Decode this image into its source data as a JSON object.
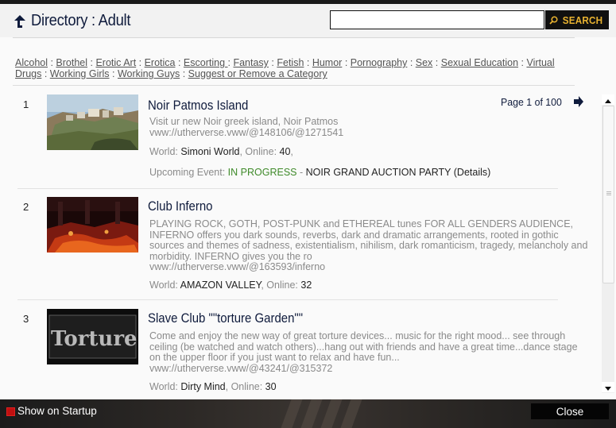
{
  "header": {
    "title": "Directory : Adult",
    "search_placeholder": "",
    "search_label": "SEARCH"
  },
  "categories": [
    "Alcohol",
    "Brothel",
    "Erotic Art",
    "Erotica",
    "Escorting ",
    "Fantasy",
    "Fetish",
    "Humor",
    "Pornography",
    "Sex",
    "Sexual Education",
    "Virtual Drugs",
    "Working Girls",
    "Working Guys",
    "Suggest or Remove a Category"
  ],
  "pager": {
    "text": "Page 1 of 100"
  },
  "items": [
    {
      "index": "1",
      "name": "Noir Patmos Island",
      "description": "Visit ur new Noir greek island, Noir Patmos",
      "url": "vww://utherverse.vww/@148106/@1271541",
      "world_label": "World: ",
      "world": "Simoni World",
      "online_label": ", Online: ",
      "online": "40",
      "online_suffix": ",",
      "event_label": "Upcoming Event: ",
      "event_status": "IN PROGRESS",
      "event_sep": " - ",
      "event_name": "NOIR GRAND AUCTION PARTY (Details)"
    },
    {
      "index": "2",
      "name": "Club Inferno",
      "description": "PLAYING ROCK, GOTH, POST-PUNK and  ETHEREAL tunes FOR ALL GENDERS AUDIENCE, INFERNO offers you dark sounds, reverbs, dark and dramatic arrangements, rooted in gothic sources and themes of sadness, existentialism, nihilism, dark romanticism, tragedy, melancholy and morbidity. INFERNO gives you the ro",
      "url": "vww://utherverse.vww/@163593/inferno",
      "world_label": "World: ",
      "world": "AMAZON VALLEY",
      "online_label": ", Online: ",
      "online": "32"
    },
    {
      "index": "3",
      "name": "Slave Club \"\"torture Garden\"\"",
      "description": "Come and enjoy the new way of great torture devices... music for the right mood... see through ceiling (be watched and watch others)...hang out with friends and have a great time...dance stage on the upper floor if you just want to relax and have fun...",
      "url": "vww://utherverse.vww/@43241/@315372",
      "world_label": "World: ",
      "world": "Dirty Mind",
      "online_label": ", Online: ",
      "online": "30",
      "thumb_text": "Torture"
    }
  ],
  "footer": {
    "startup_label": "Show on Startup",
    "close_label": "Close"
  },
  "colors": {
    "title": "#0f1b3c",
    "search_button_text": "#e8b230",
    "in_progress": "#3f8a2a",
    "startup_check": "#c01010"
  }
}
